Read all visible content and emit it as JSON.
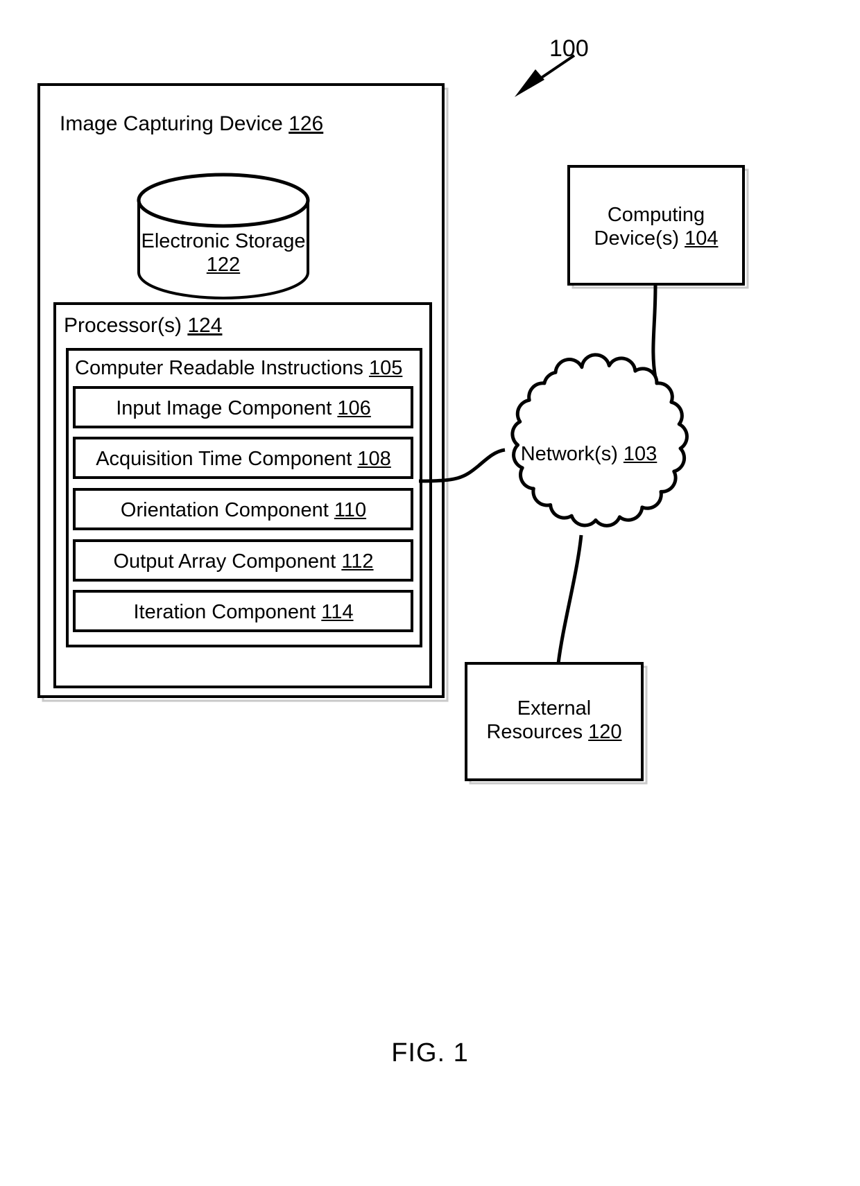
{
  "figure": {
    "caption": "FIG. 1",
    "system_reference": "100"
  },
  "blocks": {
    "image_capturing_device": {
      "label": "Image Capturing Device",
      "ref": "126"
    },
    "electronic_storage": {
      "label": "Electronic Storage",
      "ref": "122"
    },
    "processors": {
      "label": "Processor(s)",
      "ref": "124"
    },
    "computer_readable_instructions": {
      "label": "Computer Readable Instructions",
      "ref": "105"
    },
    "computing_devices": {
      "line1": "Computing",
      "line2": "Device(s)",
      "ref": "104"
    },
    "network": {
      "label": "Network(s)",
      "ref": "103"
    },
    "external_resources": {
      "line1": "External",
      "line2": "Resources",
      "ref": "120"
    }
  },
  "components": [
    {
      "label": "Input Image Component",
      "ref": "106"
    },
    {
      "label": "Acquisition Time Component",
      "ref": "108"
    },
    {
      "label": "Orientation Component",
      "ref": "110"
    },
    {
      "label": "Output Array Component",
      "ref": "112"
    },
    {
      "label": "Iteration Component",
      "ref": "114"
    }
  ],
  "colors": {
    "stroke": "#000000",
    "background": "#ffffff",
    "shadow": "#c8c8c8"
  }
}
